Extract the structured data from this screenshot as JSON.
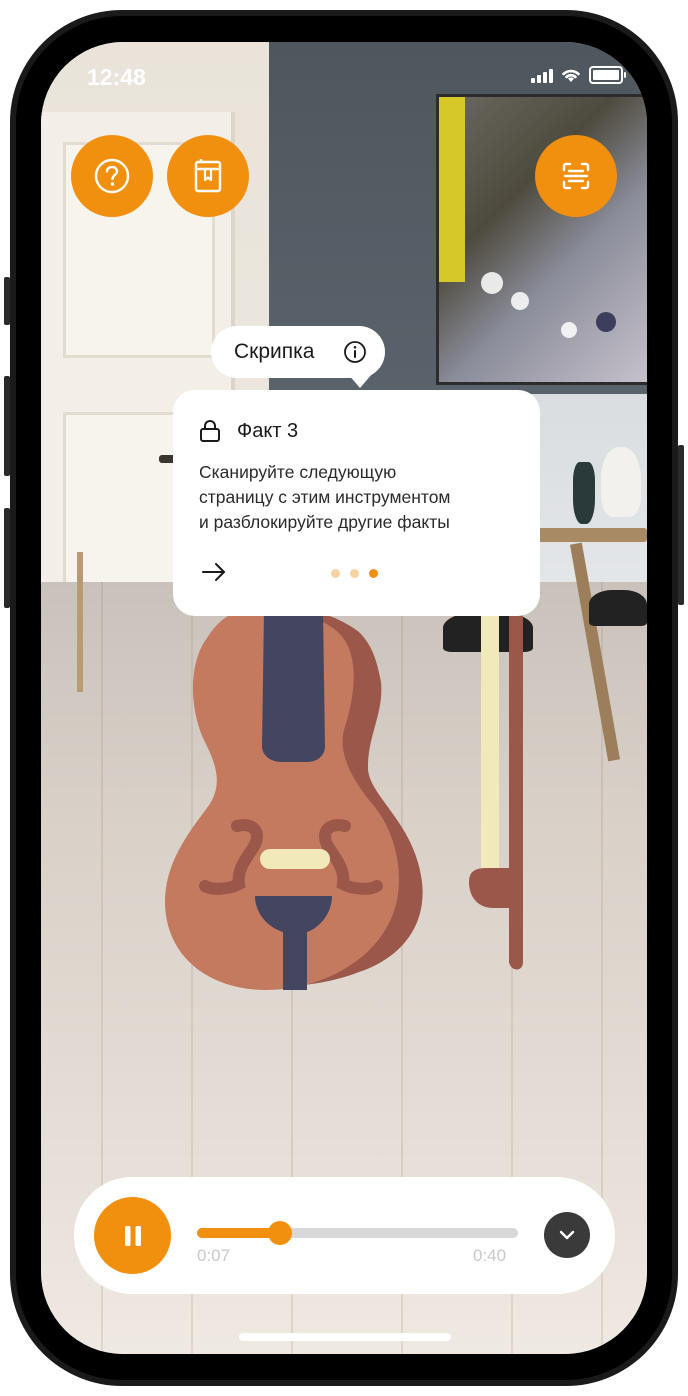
{
  "status_bar": {
    "time": "12:48"
  },
  "top_buttons": {
    "help": "help-icon",
    "book": "book-icon",
    "scan": "scan-icon"
  },
  "label_pill": {
    "text": "Скрипка",
    "icon": "info-icon"
  },
  "fact_card": {
    "title": "Факт 3",
    "lock_icon": "lock-icon",
    "lines": [
      "Сканируйте следующую",
      "страницу с этим инструментом",
      "и разблокируйте другие факты"
    ],
    "page_count": 3,
    "current_page": 3
  },
  "player": {
    "current_time": "0:07",
    "total_time": "0:40",
    "progress": 0.26,
    "pause_icon": "pause-icon",
    "collapse_icon": "chevron-down-icon"
  },
  "colors": {
    "accent": "#f18f0f",
    "dot_inactive": "#f6d3a4",
    "violin_body": "#c47a5f",
    "violin_shadow": "#9a574a",
    "violin_neck": "#444660",
    "bridge": "#f1e9b9"
  }
}
